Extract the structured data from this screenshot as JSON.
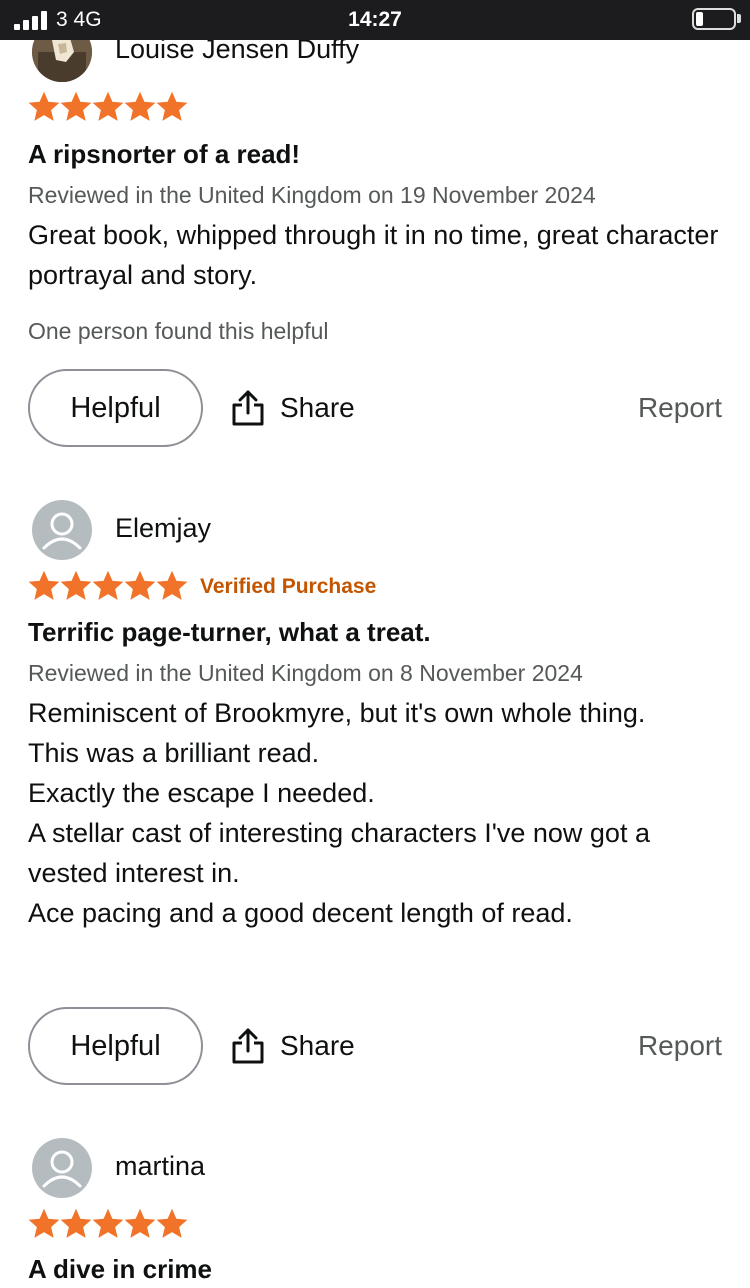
{
  "status_bar": {
    "carrier": "3  4G",
    "time": "14:27",
    "battery_level": 0.2
  },
  "reviews": [
    {
      "reviewer": "Louise Jensen Duffy",
      "avatar": "photo",
      "rating": 5,
      "verified": "",
      "title": "A ripsnorter of a read!",
      "meta": "Reviewed in the United Kingdom on 19 November 2024",
      "body": [
        "Great book, whipped through it in no time, great character portrayal and story."
      ],
      "helpful_count": "One person found this helpful",
      "helpful_label": "Helpful",
      "share_label": "Share",
      "report_label": "Report"
    },
    {
      "reviewer": "Elemjay",
      "avatar": "generic",
      "rating": 5,
      "verified": "Verified Purchase",
      "title": "Terrific page-turner, what a treat.",
      "meta": "Reviewed in the United Kingdom on 8 November 2024",
      "body": [
        "Reminiscent of Brookmyre, but it's own whole thing.",
        "This was a brilliant read.",
        "Exactly the escape I needed.",
        "A stellar cast of interesting characters I've now got a vested interest in.",
        "Ace pacing and a good decent length of read."
      ],
      "helpful_label": "Helpful",
      "share_label": "Share",
      "report_label": "Report"
    },
    {
      "reviewer": "martina",
      "avatar": "generic",
      "rating": 5,
      "title": "A dive in crime"
    }
  ],
  "colors": {
    "star": "#f1732a",
    "verified": "#c45500",
    "meta": "#565959"
  }
}
